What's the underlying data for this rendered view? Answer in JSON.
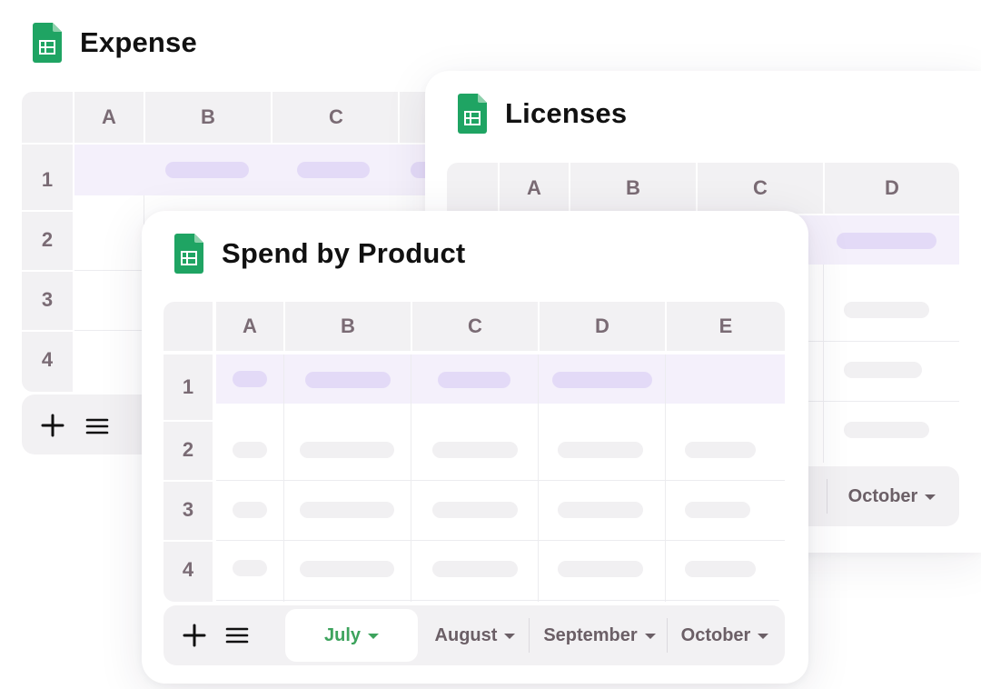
{
  "expense": {
    "title": "Expense",
    "columns": [
      "A",
      "B",
      "C"
    ],
    "rows": [
      "1",
      "2",
      "3",
      "4"
    ]
  },
  "licenses": {
    "title": "Licenses",
    "columns": [
      "A",
      "B",
      "C",
      "D"
    ],
    "tabs": [
      {
        "label": "October"
      }
    ]
  },
  "spend": {
    "title": "Spend by Product",
    "columns": [
      "A",
      "B",
      "C",
      "D",
      "E"
    ],
    "rows": [
      "1",
      "2",
      "3",
      "4"
    ],
    "tabs": [
      {
        "label": "July",
        "active": true
      },
      {
        "label": "August"
      },
      {
        "label": "September"
      },
      {
        "label": "October"
      }
    ]
  },
  "icons": {
    "sheet": "spreadsheet-icon",
    "add": "plus-icon",
    "menu": "hamburger-menu-icon",
    "caret": "caret-down-icon"
  },
  "colors": {
    "sheet_green": "#1fa463",
    "active_tab": "#3da35d",
    "highlight_row": "#f4f0fb",
    "purple_pill": "#e3daf7"
  }
}
